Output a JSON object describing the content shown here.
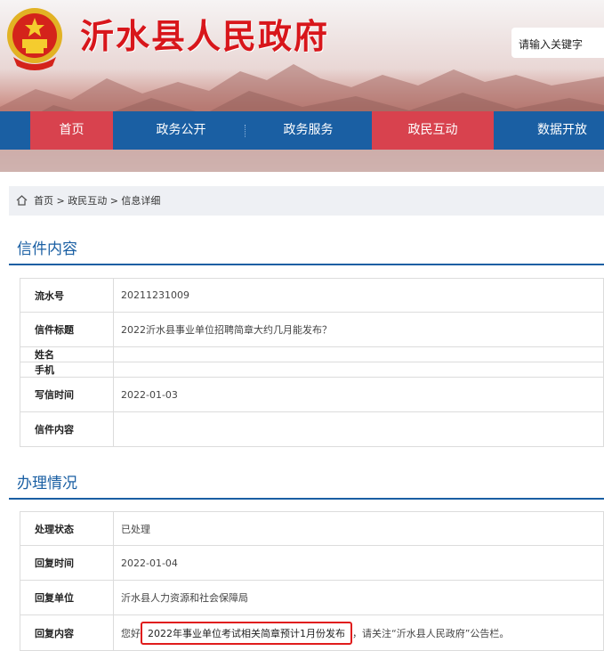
{
  "header": {
    "site_title": "沂水县人民政府",
    "search_placeholder": "请输入关键字",
    "emblem_icon": "national-emblem-icon",
    "colors": {
      "title_red": "#d8161b",
      "nav_blue": "#1a5fa3",
      "nav_active": "#d8424e"
    }
  },
  "nav": {
    "items": [
      {
        "label": "首页",
        "active": true
      },
      {
        "label": "政务公开",
        "active": false
      },
      {
        "label": "政务服务",
        "active": false
      },
      {
        "label": "政民互动",
        "active": true
      },
      {
        "label": "数据开放",
        "active": false
      }
    ]
  },
  "breadcrumb": {
    "icon": "home-icon",
    "trail": "首页 > 政民互动 > 信息详细"
  },
  "letter": {
    "section_title": "信件内容",
    "rows": [
      {
        "label": "流水号",
        "value": "20211231009"
      },
      {
        "label": "信件标题",
        "value": "2022沂水县事业单位招聘简章大约几月能发布？"
      },
      {
        "label": "姓名",
        "value": ""
      },
      {
        "label": "手机",
        "value": ""
      },
      {
        "label": "写信时间",
        "value": "2022-01-03"
      },
      {
        "label": "信件内容",
        "value": ""
      }
    ]
  },
  "handling": {
    "section_title": "办理情况",
    "rows": [
      {
        "label": "处理状态",
        "value": "已处理"
      },
      {
        "label": "回复时间",
        "value": "2022-01-04"
      },
      {
        "label": "回复单位",
        "value": "沂水县人力资源和社会保障局"
      }
    ],
    "reply": {
      "label": "回复内容",
      "prefix": "您好",
      "highlight": "2022年事业单位考试相关简章预计1月份发布",
      "suffix": "，请关注“沂水县人民政府”公告栏。"
    }
  }
}
